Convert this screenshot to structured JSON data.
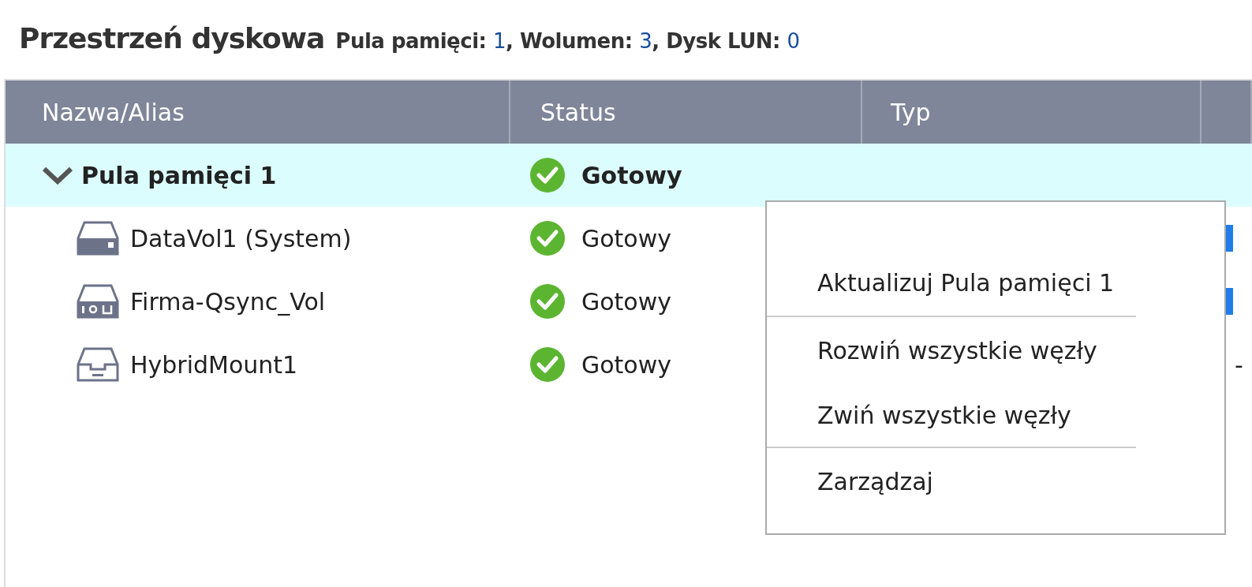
{
  "header": {
    "title": "Przestrzeń dyskowa",
    "summary": [
      {
        "label": "Pula pamięci:",
        "value": "1"
      },
      {
        "label": ", Wolumen:",
        "value": "3"
      },
      {
        "label": ", Dysk LUN:",
        "value": "0"
      }
    ]
  },
  "table": {
    "columns": [
      "Nazwa/Alias",
      "Status",
      "Typ",
      ""
    ],
    "rows": [
      {
        "kind": "pool",
        "name": "Pula pamięci 1",
        "expanded": true,
        "selected": true,
        "status": "Gotowy",
        "column_4": {
          "kind": "none"
        }
      },
      {
        "kind": "volume",
        "name": "DataVol1 (System)",
        "selected": false,
        "status": "Gotowy",
        "column_4": {
          "kind": "bar"
        }
      },
      {
        "kind": "volume",
        "name": "Firma-Qsync_Vol",
        "selected": false,
        "status": "Gotowy",
        "column_4": {
          "kind": "bar"
        }
      },
      {
        "kind": "volume",
        "name": "HybridMount1",
        "selected": false,
        "status": "Gotowy",
        "column_4": {
          "kind": "text",
          "text": "-"
        }
      }
    ]
  },
  "context_menu": {
    "items": [
      {
        "kind": "item",
        "label": "Aktualizuj Pula pamięci 1"
      },
      {
        "kind": "separator"
      },
      {
        "kind": "item",
        "label": "Rozwiń wszystkie węzły"
      },
      {
        "kind": "item",
        "label": "Zwiń wszystkie węzły"
      },
      {
        "kind": "separator"
      },
      {
        "kind": "item",
        "label": "Zarządzaj"
      }
    ]
  }
}
